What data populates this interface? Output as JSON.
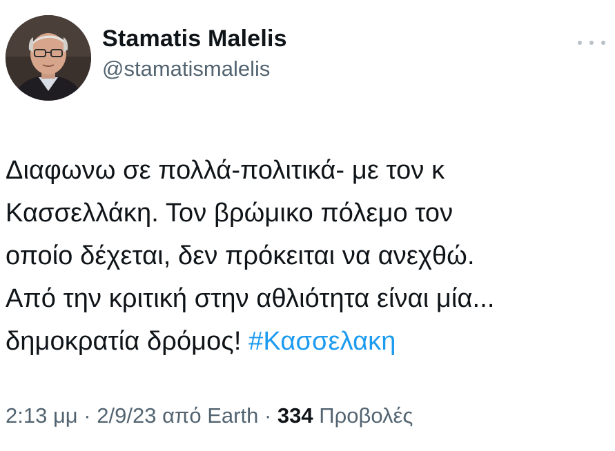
{
  "author": {
    "display_name": "Stamatis Malelis",
    "handle": "@stamatismalelis"
  },
  "more_icon": "more-horizontal-icon",
  "tweet": {
    "lines": [
      "Διαφωνω σε πολλά-πολιτικά- με τον κ",
      "Κασσελλάκη. Τον βρώμικο πόλεμο τον",
      "οποίο δέχεται, δεν πρόκειται να ανεχθώ.",
      "Από την κριτική στην αθλιότητα είναι μία...",
      "δημοκρατία δρόμος!"
    ],
    "hashtag": "#Κασσελακη"
  },
  "meta": {
    "time": "2:13 μμ",
    "date": "2/9/23",
    "source": "από Earth",
    "separator": "·",
    "views_count": "334",
    "views_label": "Προβολές"
  },
  "colors": {
    "link": "#1d9bf0",
    "secondary_text": "#536471",
    "primary_text": "#0f1419"
  }
}
